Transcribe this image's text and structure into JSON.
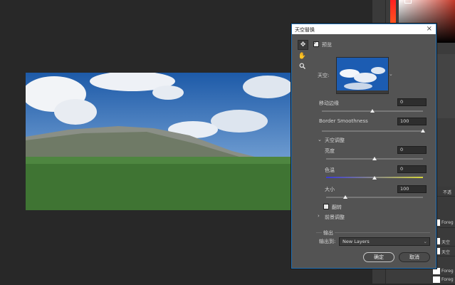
{
  "dialog": {
    "title": "天空替换",
    "close": "×",
    "preview_label": "预览",
    "sky_label": "天空:",
    "shift_edge_label": "移动边缘",
    "shift_edge_value": "0",
    "fade_edge_label": "Border Smoothness",
    "fade_edge_value": "100",
    "sky_adjust_label": "天空调整",
    "brightness_label": "亮度",
    "brightness_value": "0",
    "temperature_label": "色温",
    "temperature_value": "0",
    "scale_label": "大小",
    "scale_value": "100",
    "flip_label": "翻转",
    "foreground_label": "前景调整",
    "output_label": "输出",
    "output_to_label": "输出到:",
    "output_to_value": "New Layers",
    "ok_label": "确定",
    "cancel_label": "取消"
  },
  "sliders": {
    "shift_edge": 0.5,
    "fade_edge": 1.0,
    "brightness": 0.5,
    "temperature": 0.5,
    "scale": 0.2
  },
  "layers": {
    "rows": [
      "Foreg",
      "天空",
      "天空",
      "Foreg",
      "Foreg"
    ],
    "panel_tab": "不透"
  },
  "colors": {
    "dialog_bg": "#535353",
    "accent": "#1f6fb5",
    "temperature_gradient_start": "#3b3bd6",
    "temperature_gradient_end": "#d6d63b"
  }
}
